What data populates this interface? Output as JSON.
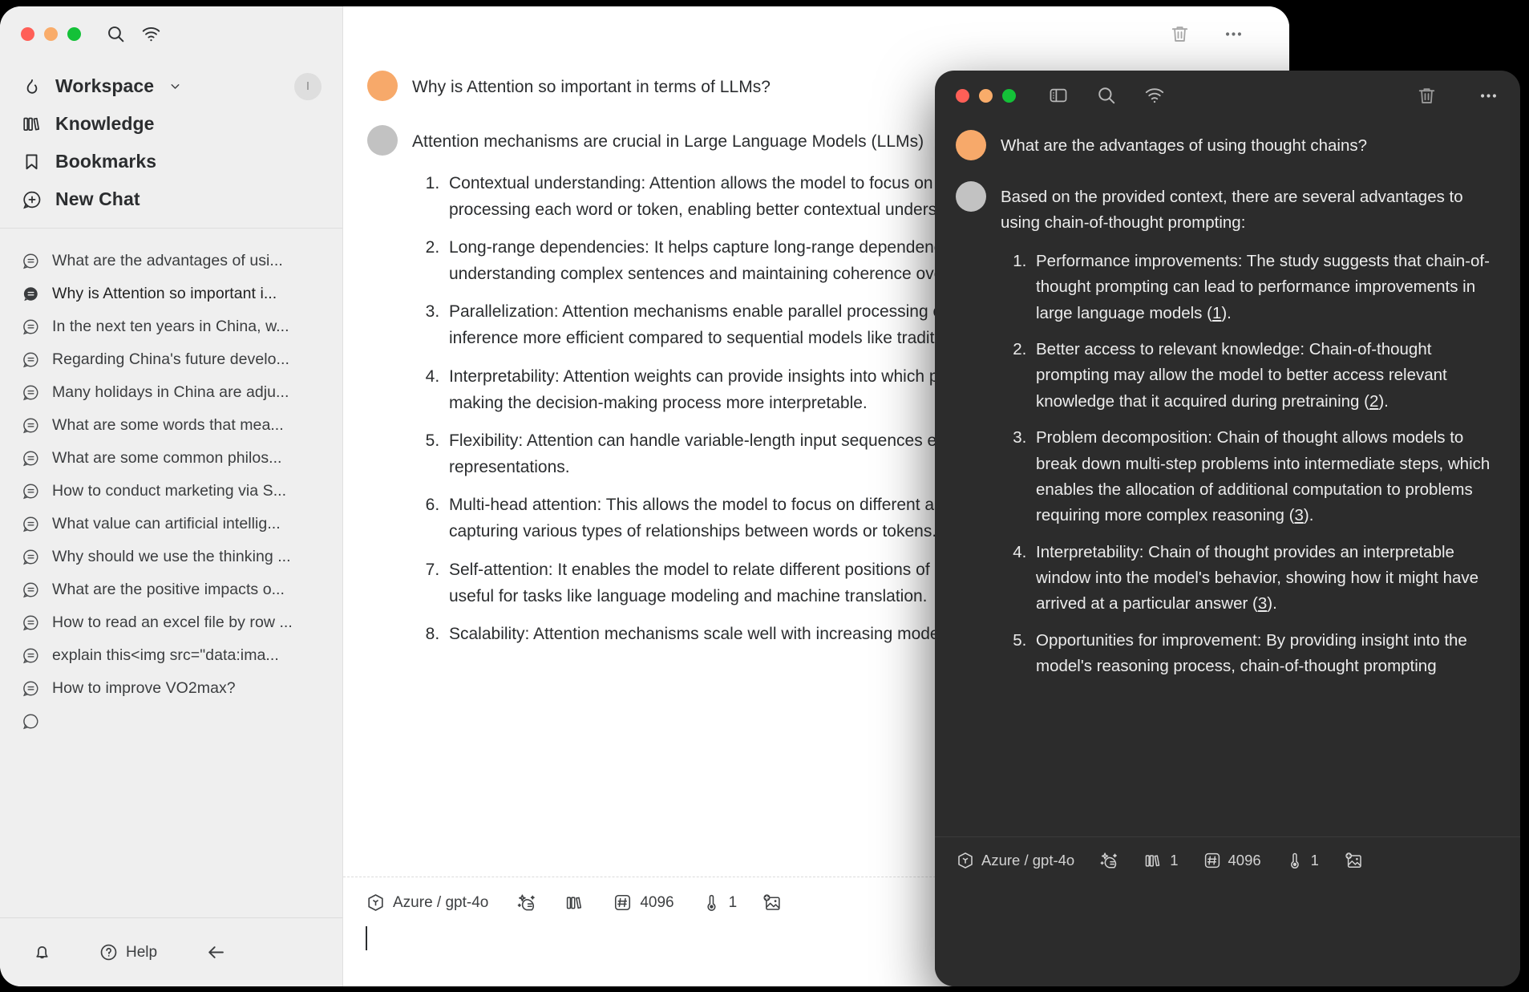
{
  "light_window": {
    "sidebar": {
      "traffic_lights": [
        "close",
        "minimize",
        "zoom"
      ],
      "top_icons": [
        "search-icon",
        "wifi-icon"
      ],
      "nav": [
        {
          "icon": "flame-icon",
          "label": "Workspace",
          "has_chevron": true,
          "badge": "I"
        },
        {
          "icon": "books-icon",
          "label": "Knowledge",
          "has_chevron": false
        },
        {
          "icon": "bookmark-icon",
          "label": "Bookmarks",
          "has_chevron": false
        },
        {
          "icon": "plus-chat-icon",
          "label": "New Chat",
          "has_chevron": false
        }
      ],
      "chats": [
        {
          "label": "What are the advantages of usi...",
          "active": false
        },
        {
          "label": "Why is Attention so important i...",
          "active": true
        },
        {
          "label": "In the next ten years in China, w...",
          "active": false
        },
        {
          "label": "Regarding China's future develo...",
          "active": false
        },
        {
          "label": "Many holidays in China are adju...",
          "active": false
        },
        {
          "label": "What are some words that mea...",
          "active": false
        },
        {
          "label": "What are some common philos...",
          "active": false
        },
        {
          "label": "How to conduct marketing via S...",
          "active": false
        },
        {
          "label": "What value can artificial intellig...",
          "active": false
        },
        {
          "label": "Why should we use the thinking ...",
          "active": false
        },
        {
          "label": "What are the positive impacts o...",
          "active": false
        },
        {
          "label": "How to read an excel file by row ...",
          "active": false
        },
        {
          "label": "explain this<img src=\"data:ima...",
          "active": false
        },
        {
          "label": "How to improve VO2max?",
          "active": false
        }
      ],
      "footer": {
        "bell_icon": "bell-icon",
        "help_icon": "question-circle-icon",
        "help_label": "Help",
        "back_icon": "arrow-left-icon"
      }
    },
    "header_icons": [
      "trash-icon",
      "more-horizontal-icon"
    ],
    "conversation": {
      "user_message": "Why is Attention so important in terms of LLMs?",
      "bot_intro": "Attention mechanisms are crucial in Large Language Models (LLMs)",
      "bot_list": [
        "Contextual understanding: Attention allows the model to focus on relevant parts of the input when processing each word or token, enabling better contextual understanding.",
        "Long-range dependencies: It helps capture long-range dependencies between words, which is essential for understanding complex sentences and maintaining coherence over longer texts.",
        "Parallelization: Attention mechanisms enable parallel processing of input sequences, making training and inference more efficient compared to sequential models like traditional RNNs.",
        "Interpretability: Attention weights can provide insights into which parts of the input the model is focusing on, making the decision-making process more interpretable.",
        "Flexibility: Attention can handle variable-length input sequences effectively, without requiring fixed-size representations.",
        "Multi-head attention: This allows the model to focus on different aspects of the input simultaneously, capturing various types of relationships between words or tokens.",
        "Self-attention: It enables the model to relate different positions of a single sequence, which is particularly useful for tasks like language modeling and machine translation.",
        "Scalability: Attention mechanisms scale well with increasing model size and data."
      ]
    },
    "composer": {
      "model_icon": "cube-icon",
      "model_label": "Azure / gpt-4o",
      "prompt_icon": "magic-prompt-icon",
      "knowledge_icon": "books-icon",
      "token_icon": "hash-icon",
      "token_value": "4096",
      "temperature_icon": "thermometer-icon",
      "temperature_value": "1",
      "image_icon": "add-image-icon",
      "input_value": "",
      "input_placeholder": ""
    }
  },
  "dark_window": {
    "traffic_lights": [
      "close",
      "minimize",
      "zoom"
    ],
    "top_icons": [
      "sidebar-toggle-icon",
      "search-icon",
      "wifi-icon"
    ],
    "header_right_icons": [
      "trash-icon",
      "more-horizontal-icon"
    ],
    "conversation": {
      "user_message": "What are the advantages of using thought chains?",
      "bot_intro": "Based on the provided context, there are several advantages to using chain-of-thought prompting:",
      "bot_list": [
        {
          "text": "Performance improvements: The study suggests that chain-of-thought prompting can lead to performance improvements in large language models ",
          "cite": "1"
        },
        {
          "text": "Better access to relevant knowledge: Chain-of-thought prompting may allow the model to better access relevant knowledge that it acquired during pretraining ",
          "cite": "2"
        },
        {
          "text": "Problem decomposition: Chain of thought allows models to break down multi-step problems into intermediate steps, which enables the allocation of additional computation to problems requiring more complex reasoning ",
          "cite": "3"
        },
        {
          "text": "Interpretability: Chain of thought provides an interpretable window into the model's behavior, showing how it might have arrived at a particular answer ",
          "cite": "3"
        },
        {
          "text": "Opportunities for improvement: By providing insight into the model's reasoning process, chain-of-thought prompting",
          "cite": ""
        }
      ]
    },
    "composer": {
      "model_icon": "cube-icon",
      "model_label": "Azure / gpt-4o",
      "prompt_icon": "magic-prompt-icon",
      "knowledge_icon": "books-icon",
      "knowledge_value": "1",
      "token_icon": "hash-icon",
      "token_value": "4096",
      "temperature_icon": "thermometer-icon",
      "temperature_value": "1",
      "image_icon": "add-image-icon"
    }
  },
  "colors": {
    "accent_orange": "#f7a96a",
    "bot_gray": "#c2c2c2",
    "sidebar_bg": "#efefef",
    "dark_bg": "#2c2c2c",
    "traffic_red": "#ff5f57",
    "traffic_yellow": "#f9ac6a",
    "traffic_green": "#14c138"
  }
}
